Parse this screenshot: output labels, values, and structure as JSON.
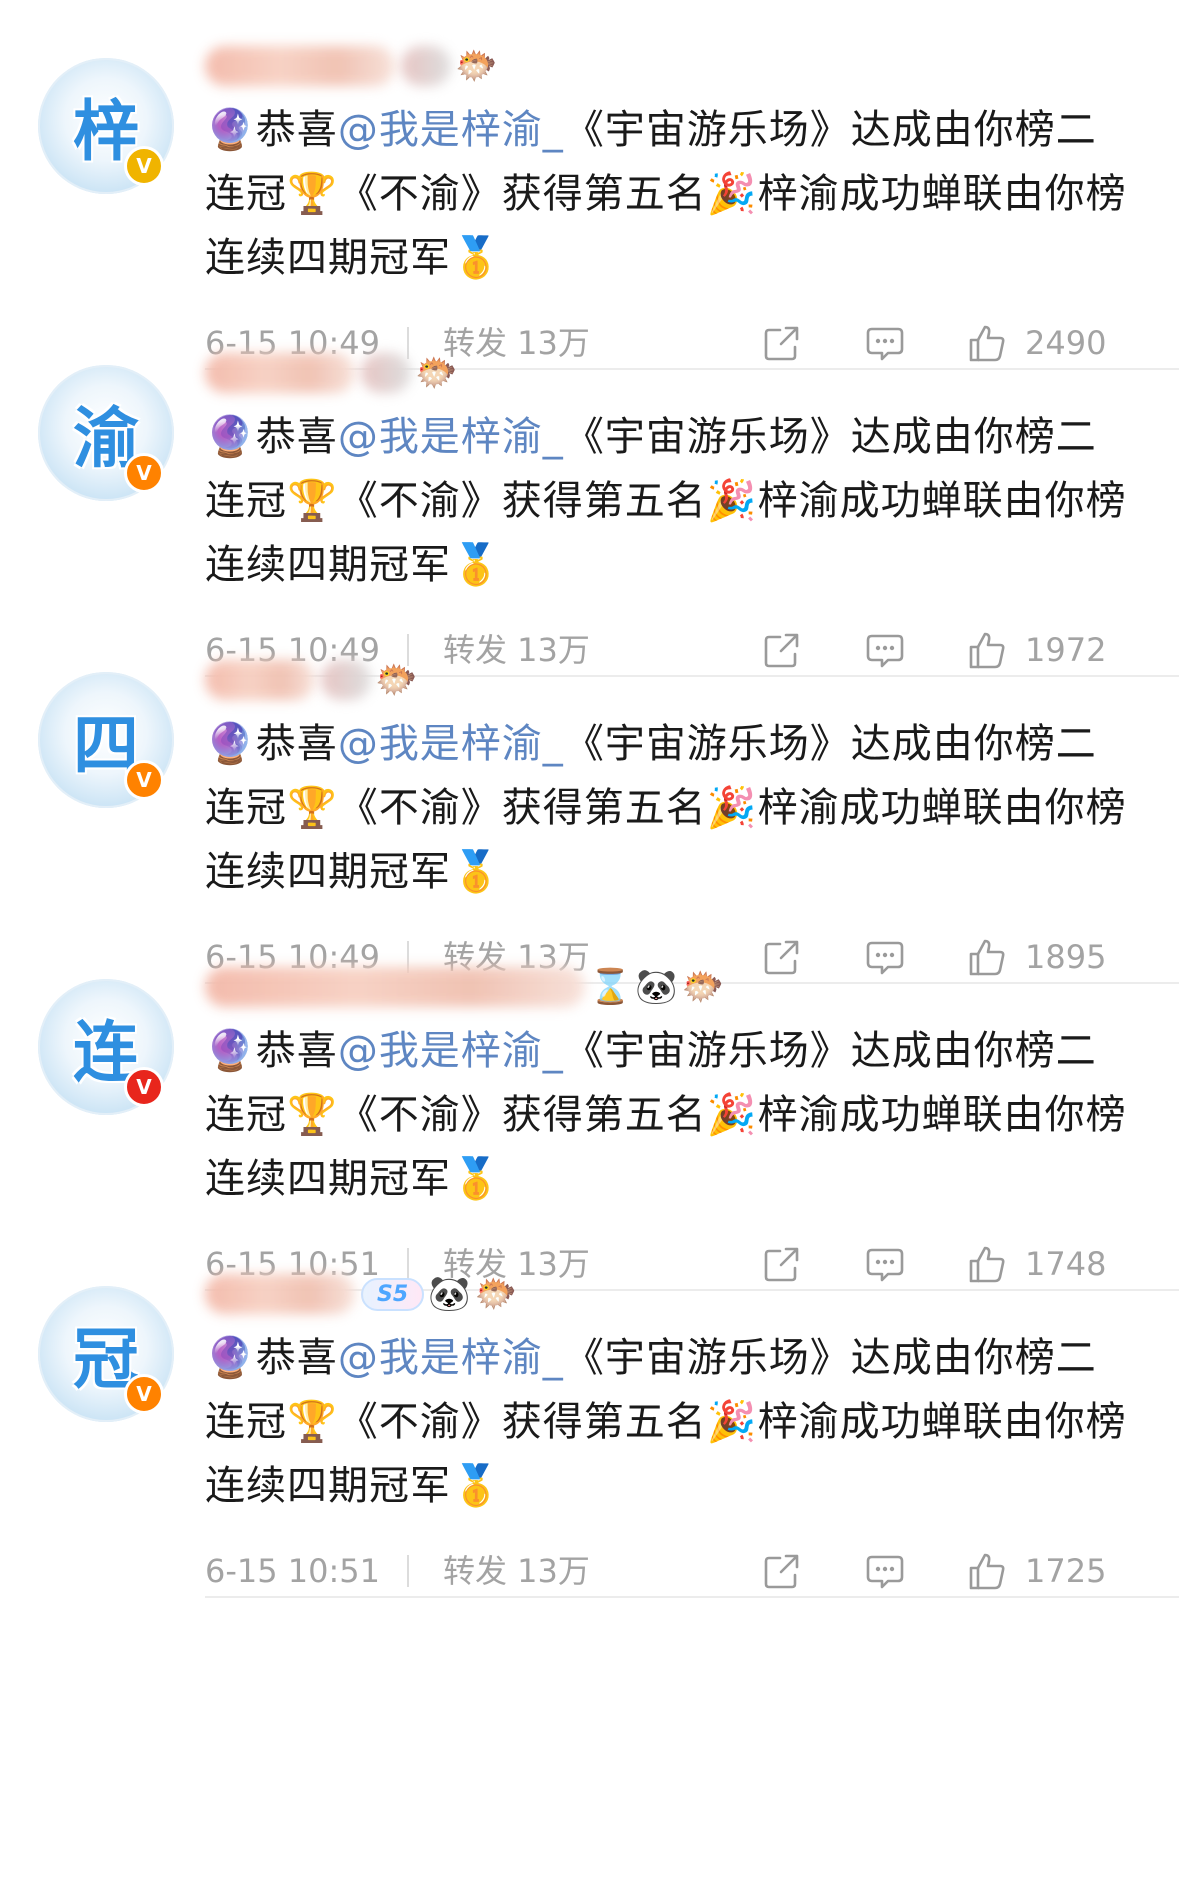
{
  "posts": [
    {
      "avatar_char": "梓",
      "badge": "V",
      "badge_color": "#f0b400",
      "name_emojis": [
        "🐡"
      ],
      "text_parts": {
        "prefix": "🔮恭喜",
        "mention": "@我是梓渝_",
        "rest": "《宇宙游乐场》达成由你榜二连冠🏆《不渝》获得第五名🎉梓渝成功蝉联由你榜连续四期冠军🥇"
      },
      "time": "6-15 10:49",
      "repost_label": "转发 13万",
      "likes": "2490"
    },
    {
      "avatar_char": "渝",
      "badge": "V",
      "badge_color": "#ff8200",
      "name_emojis": [
        "🐡"
      ],
      "text_parts": {
        "prefix": "🔮恭喜",
        "mention": "@我是梓渝_",
        "rest": "《宇宙游乐场》达成由你榜二连冠🏆《不渝》获得第五名🎉梓渝成功蝉联由你榜连续四期冠军🥇"
      },
      "time": "6-15 10:49",
      "repost_label": "转发 13万",
      "likes": "1972"
    },
    {
      "avatar_char": "四",
      "badge": "V",
      "badge_color": "#ff8200",
      "name_emojis": [
        "🐡"
      ],
      "text_parts": {
        "prefix": "🔮恭喜",
        "mention": "@我是梓渝_",
        "rest": "《宇宙游乐场》达成由你榜二连冠🏆《不渝》获得第五名🎉梓渝成功蝉联由你榜连续四期冠军🥇"
      },
      "time": "6-15 10:49",
      "repost_label": "转发 13万",
      "likes": "1895"
    },
    {
      "avatar_char": "连",
      "badge": "V",
      "badge_color": "#e8261c",
      "name_emojis": [
        "⌛",
        "🐼",
        "🐡"
      ],
      "text_parts": {
        "prefix": "🔮恭喜",
        "mention": "@我是梓渝_",
        "rest": "《宇宙游乐场》达成由你榜二连冠🏆《不渝》获得第五名🎉梓渝成功蝉联由你榜连续四期冠军🥇"
      },
      "time": "6-15 10:51",
      "repost_label": "转发 13万",
      "likes": "1748"
    },
    {
      "avatar_char": "冠",
      "badge": "V",
      "badge_color": "#ff8200",
      "name_emojis": [
        "🐼",
        "🐡"
      ],
      "s5_label": "S5",
      "text_parts": {
        "prefix": "🔮恭喜",
        "mention": "@我是梓渝_",
        "rest": "《宇宙游乐场》达成由你榜二连冠🏆《不渝》获得第五名🎉梓渝成功蝉联由你榜连续四期冠军🥇"
      },
      "time": "6-15 10:51",
      "repost_label": "转发 13万",
      "likes": "1725"
    }
  ]
}
